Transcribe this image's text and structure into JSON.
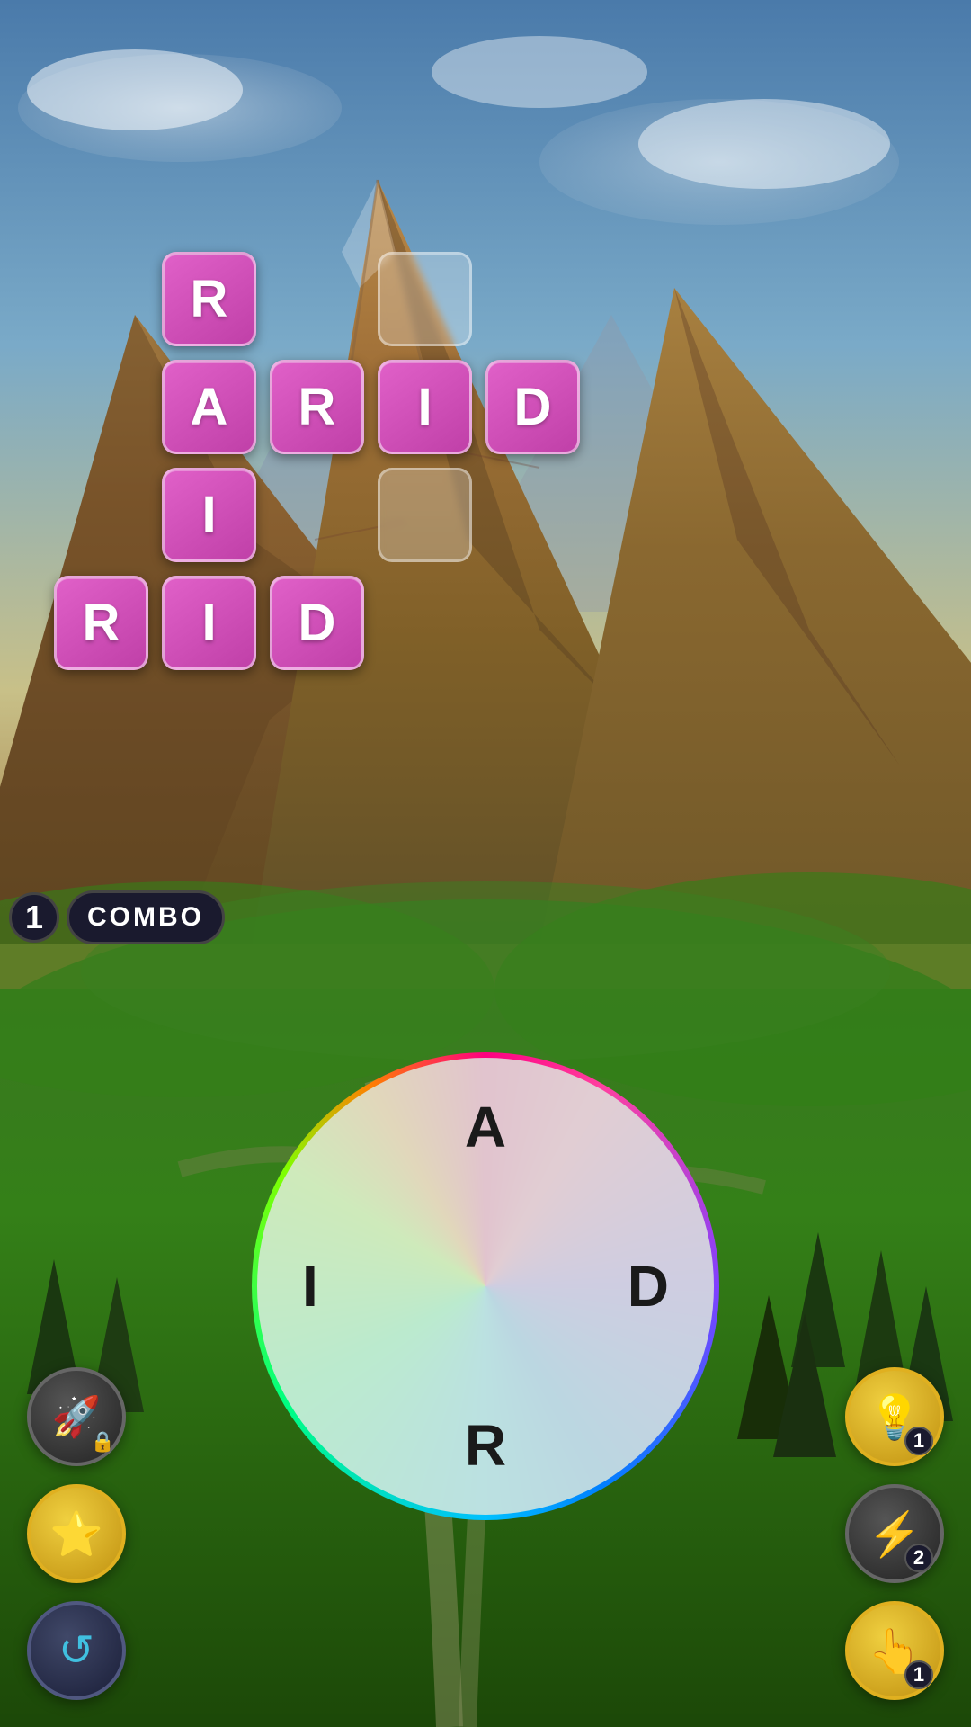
{
  "background": {
    "sky_color_top": "#5a8ab8",
    "sky_color_bottom": "#c8b870",
    "grass_color": "#3a7020"
  },
  "grid": {
    "tiles": [
      {
        "row": 0,
        "col": 0,
        "type": "hidden",
        "letter": ""
      },
      {
        "row": 0,
        "col": 1,
        "type": "filled",
        "letter": "R"
      },
      {
        "row": 0,
        "col": 2,
        "type": "hidden",
        "letter": ""
      },
      {
        "row": 0,
        "col": 3,
        "type": "empty",
        "letter": ""
      },
      {
        "row": 1,
        "col": 0,
        "type": "hidden",
        "letter": ""
      },
      {
        "row": 1,
        "col": 1,
        "type": "filled",
        "letter": "A"
      },
      {
        "row": 1,
        "col": 2,
        "type": "filled",
        "letter": "R"
      },
      {
        "row": 1,
        "col": 3,
        "type": "filled",
        "letter": "I"
      },
      {
        "row": 1,
        "col": 4,
        "type": "filled",
        "letter": "D"
      },
      {
        "row": 2,
        "col": 0,
        "type": "hidden",
        "letter": ""
      },
      {
        "row": 2,
        "col": 1,
        "type": "filled",
        "letter": "I"
      },
      {
        "row": 2,
        "col": 2,
        "type": "hidden",
        "letter": ""
      },
      {
        "row": 2,
        "col": 3,
        "type": "empty",
        "letter": ""
      },
      {
        "row": 3,
        "col": 0,
        "type": "filled",
        "letter": "R"
      },
      {
        "row": 3,
        "col": 1,
        "type": "filled",
        "letter": "I"
      },
      {
        "row": 3,
        "col": 2,
        "type": "filled",
        "letter": "D"
      },
      {
        "row": 3,
        "col": 3,
        "type": "hidden",
        "letter": ""
      }
    ]
  },
  "combo": {
    "number": "1",
    "label": "COMBO"
  },
  "wheel": {
    "letters": {
      "top": "A",
      "left": "I",
      "right": "D",
      "bottom": "R"
    }
  },
  "buttons": {
    "left": [
      {
        "id": "rocket",
        "emoji": "🚀",
        "style": "dark",
        "badge": "lock",
        "badge_icon": "🔒"
      },
      {
        "id": "star",
        "emoji": "⭐",
        "style": "yellow",
        "badge": null
      },
      {
        "id": "refresh",
        "emoji": "🔄",
        "style": "dark-teal",
        "badge": null
      }
    ],
    "right": [
      {
        "id": "lightbulb",
        "emoji": "💡",
        "style": "yellow",
        "badge": "1"
      },
      {
        "id": "lightning",
        "emoji": "⚡",
        "style": "dark",
        "badge": "2"
      },
      {
        "id": "hand",
        "emoji": "👆",
        "style": "yellow",
        "badge": "1"
      }
    ]
  }
}
